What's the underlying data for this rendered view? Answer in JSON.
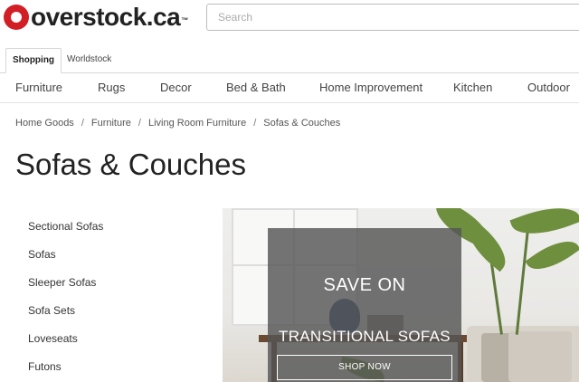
{
  "header": {
    "logo_text": "overstock.ca",
    "logo_tm": "™",
    "search_placeholder": "Search"
  },
  "store_tabs": [
    {
      "label": "Shopping",
      "active": true
    },
    {
      "label": "Worldstock",
      "active": false
    }
  ],
  "category_nav": [
    "Furniture",
    "Rugs",
    "Decor",
    "Bed & Bath",
    "Home Improvement",
    "Kitchen",
    "Outdoor"
  ],
  "breadcrumb": [
    "Home Goods",
    "Furniture",
    "Living Room Furniture",
    "Sofas & Couches"
  ],
  "page_title": "Sofas & Couches",
  "sidebar": [
    "Sectional Sofas",
    "Sofas",
    "Sleeper Sofas",
    "Sofa Sets",
    "Loveseats",
    "Futons"
  ],
  "banner": {
    "title": "SAVE ON",
    "subtitle": "TRANSITIONAL SOFAS",
    "button_label": "SHOP NOW"
  },
  "colors": {
    "brand_red": "#d21f26",
    "text_dark": "#222222",
    "overlay": "#555555"
  }
}
